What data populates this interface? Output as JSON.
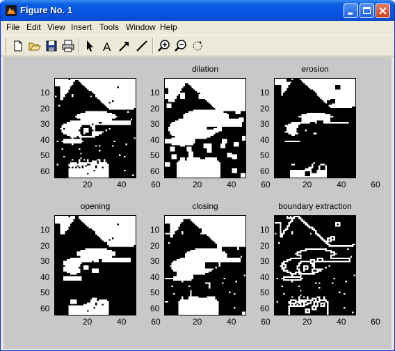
{
  "window": {
    "title": "Figure No. 1",
    "icon": "matlab-figure-icon",
    "controls": [
      "minimize-icon",
      "maximize-icon",
      "close-icon"
    ]
  },
  "menu": [
    "File",
    "Edit",
    "View",
    "Insert",
    "Tools",
    "Window",
    "Help"
  ],
  "toolbar": [
    "new-figure-icon",
    "open-file-icon",
    "save-icon",
    "print-icon",
    "arrow-select-icon",
    "insert-text-icon",
    "insert-arrow-icon",
    "insert-line-icon",
    "zoom-in-icon",
    "zoom-out-icon",
    "rotate-3d-icon"
  ],
  "subplots": [
    {
      "title": "",
      "method": "original"
    },
    {
      "title": "dilation",
      "method": "dilation"
    },
    {
      "title": "erosion",
      "method": "erosion"
    },
    {
      "title": "opening",
      "method": "opening"
    },
    {
      "title": "closing",
      "method": "closing"
    },
    {
      "title": "boundary extraction",
      "method": "boundary"
    }
  ],
  "axes": {
    "yticks": [
      "10",
      "20",
      "30",
      "40",
      "50",
      "60"
    ],
    "xticks": [
      "20",
      "40",
      "60"
    ]
  },
  "colors": {
    "titlebar": "#0a5fe0",
    "figure_bg": "#c8c8c8",
    "window_bg": "#ece9d8"
  }
}
